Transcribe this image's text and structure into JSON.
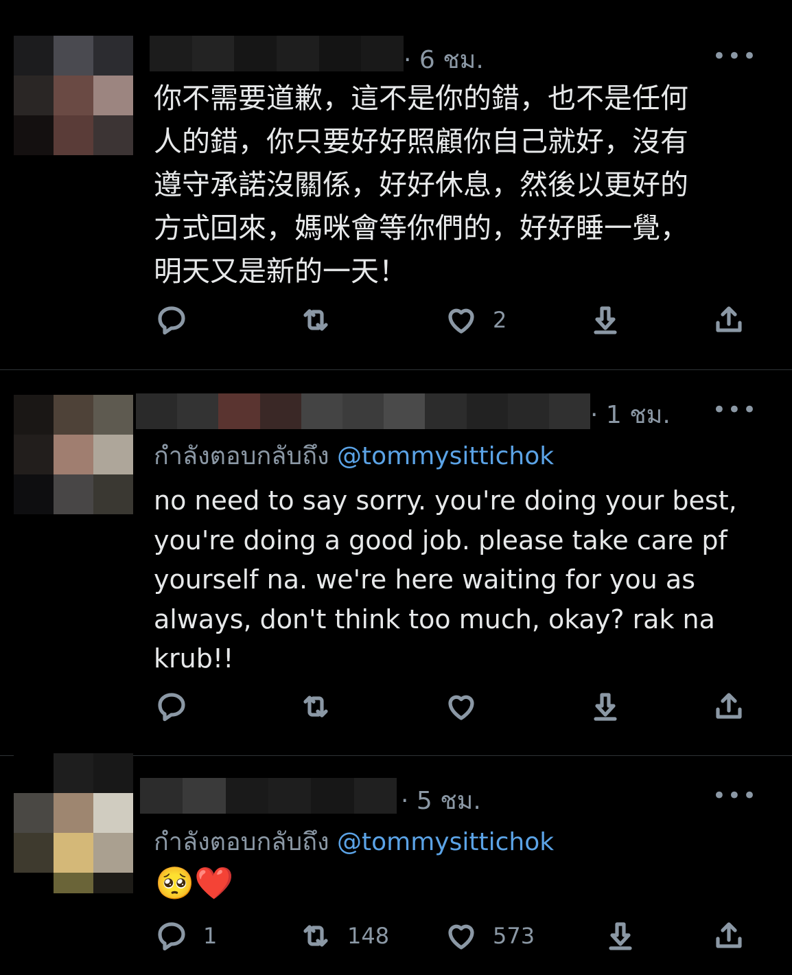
{
  "tweets": [
    {
      "time": "· 6 ชม.",
      "more": "•••",
      "text": "你不需要道歉，這不是你的錯，也不是任何\n人的錯，你只要好好照顧你自己就好，沒有\n遵守承諾沒關係，好好休息，然後以更好的\n方式回來，媽咪會等你們的，好好睡一覺，\n明天又是新的一天！",
      "likes": "2"
    },
    {
      "time": "· 1 ชม.",
      "more": "•••",
      "reply_prefix": "กำลังตอบกลับถึง ",
      "reply_handle": "@tommysittichok",
      "text": "no need to say sorry. you're doing your best,\nyou're doing a good job. please take care pf\nyourself na. we're here waiting for you as\nalways, don't think too much, okay? rak na\nkrub!!"
    },
    {
      "time": "· 5 ชม.",
      "more": "•••",
      "reply_prefix": "กำลังตอบกลับถึง ",
      "reply_handle": "@tommysittichok",
      "text": "🥺❤️",
      "replies": "1",
      "retweets": "148",
      "likes": "573"
    }
  ],
  "icons": [
    "reply-icon",
    "retweet-icon",
    "like-icon",
    "download-icon",
    "share-icon"
  ],
  "colors": {
    "background": "#000000",
    "text": "#e7e9ea",
    "muted": "#8b98a5",
    "link": "#5ba3e6"
  }
}
